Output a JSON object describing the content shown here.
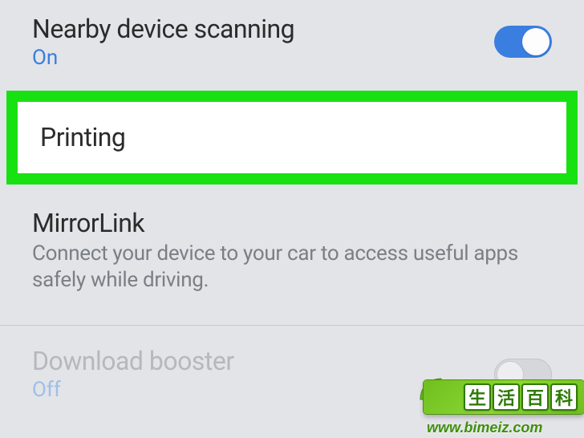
{
  "settings": {
    "nearby": {
      "title": "Nearby device scanning",
      "status": "On",
      "toggle": true
    },
    "printing": {
      "title": "Printing"
    },
    "mirrorlink": {
      "title": "MirrorLink",
      "subtitle": "Connect your device to your car to access useful apps safely while driving."
    },
    "download_booster": {
      "title": "Download booster",
      "status": "Off",
      "toggle": false,
      "disabled": true
    }
  },
  "watermark": {
    "chars": [
      "生",
      "活",
      "百",
      "科"
    ],
    "url": "www.bimeiz.com"
  }
}
